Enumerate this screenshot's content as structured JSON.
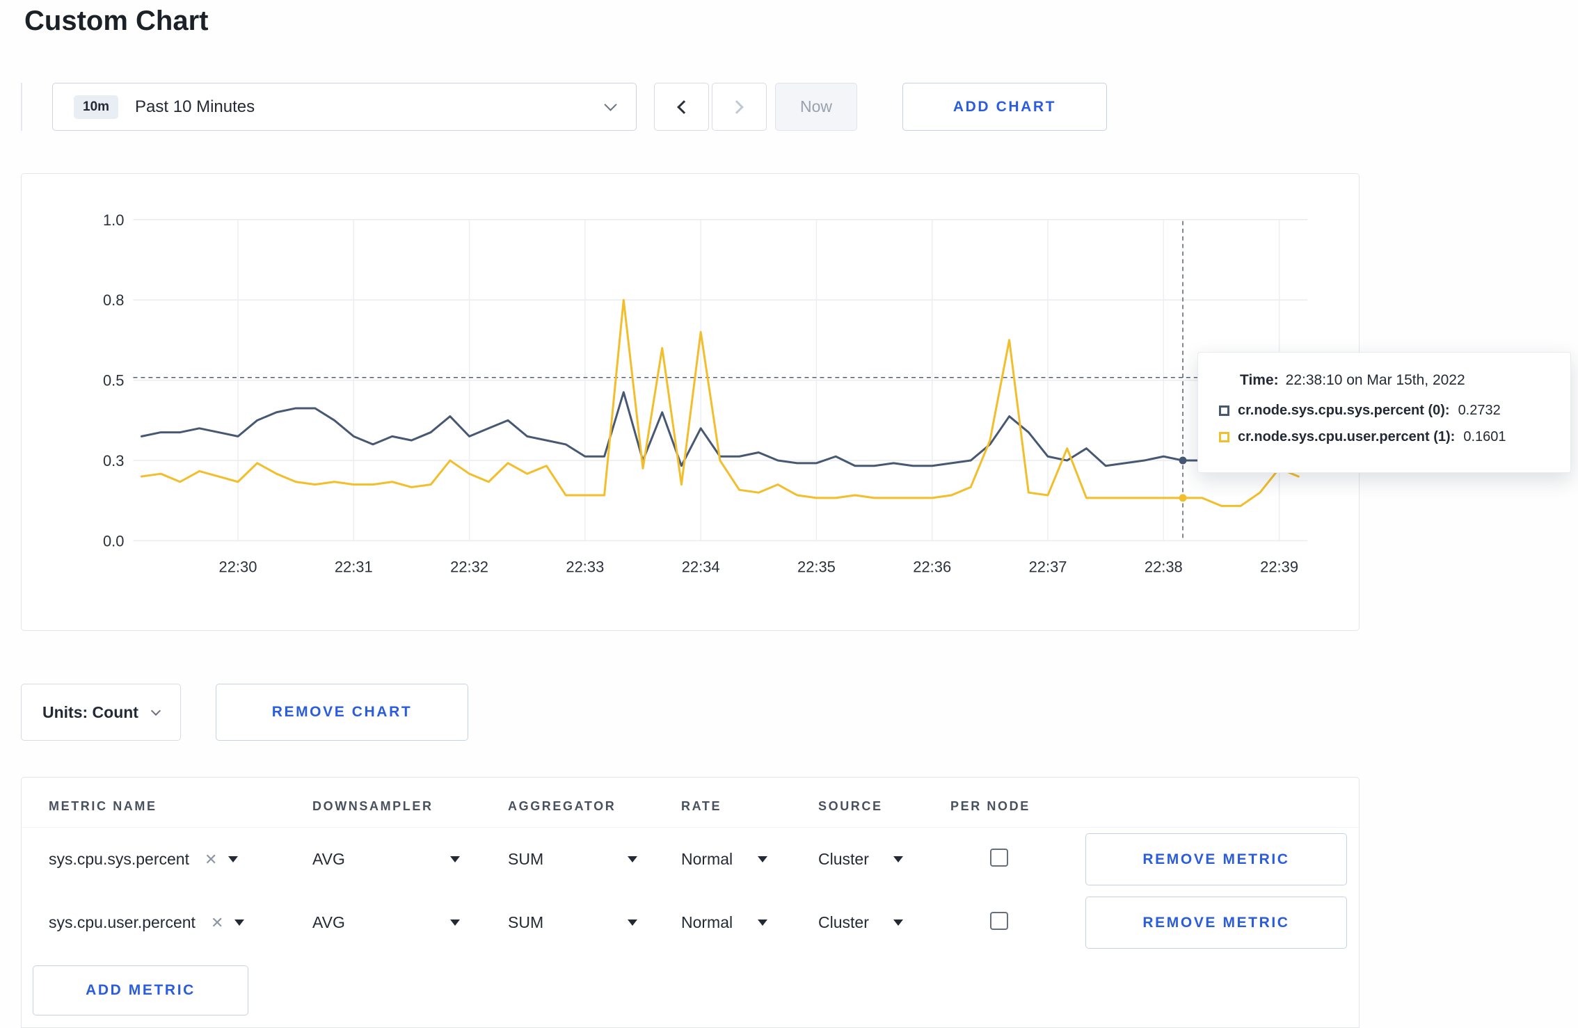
{
  "page": {
    "title": "Custom Chart"
  },
  "toolbar": {
    "time_badge": "10m",
    "time_label": "Past 10 Minutes",
    "now_label": "Now",
    "add_chart_label": "ADD CHART"
  },
  "chart_data": {
    "type": "line",
    "title": "",
    "xlabel": "",
    "ylabel": "",
    "ylim": [
      0,
      1.0
    ],
    "yticks": [
      0.0,
      0.3,
      0.5,
      0.8,
      1.0
    ],
    "x_tick_labels": [
      "22:30",
      "22:31",
      "22:32",
      "22:33",
      "22:34",
      "22:35",
      "22:36",
      "22:37",
      "22:38",
      "22:39"
    ],
    "points_per_minute": 6,
    "grid": true,
    "legend_position": "tooltip",
    "hline_value": 0.51,
    "crosshair_index": 54,
    "crosshair_time": "22:38:10",
    "series": [
      {
        "name": "cr.node.sys.cpu.sys.percent",
        "color": "#475872",
        "values": [
          0.36,
          0.37,
          0.37,
          0.38,
          0.37,
          0.36,
          0.4,
          0.42,
          0.43,
          0.43,
          0.4,
          0.36,
          0.34,
          0.36,
          0.35,
          0.37,
          0.41,
          0.36,
          0.38,
          0.4,
          0.36,
          0.35,
          0.34,
          0.31,
          0.31,
          0.47,
          0.3,
          0.42,
          0.28,
          0.38,
          0.31,
          0.31,
          0.32,
          0.3,
          0.29,
          0.29,
          0.31,
          0.28,
          0.28,
          0.29,
          0.28,
          0.28,
          0.29,
          0.3,
          0.34,
          0.41,
          0.37,
          0.31,
          0.3,
          0.33,
          0.28,
          0.29,
          0.3,
          0.31,
          0.3,
          0.3,
          0.32,
          0.3,
          0.3,
          0.31,
          0.31
        ]
      },
      {
        "name": "cr.node.sys.cpu.user.percent",
        "color": "#f2be2b",
        "values": [
          0.24,
          0.25,
          0.22,
          0.26,
          0.24,
          0.22,
          0.29,
          0.25,
          0.22,
          0.21,
          0.22,
          0.21,
          0.21,
          0.22,
          0.2,
          0.21,
          0.3,
          0.25,
          0.22,
          0.29,
          0.25,
          0.28,
          0.17,
          0.17,
          0.17,
          0.8,
          0.27,
          0.62,
          0.21,
          0.68,
          0.3,
          0.19,
          0.18,
          0.21,
          0.17,
          0.16,
          0.16,
          0.17,
          0.16,
          0.16,
          0.16,
          0.16,
          0.17,
          0.2,
          0.35,
          0.65,
          0.18,
          0.17,
          0.33,
          0.16,
          0.16,
          0.16,
          0.16,
          0.16,
          0.16,
          0.16,
          0.13,
          0.13,
          0.18,
          0.27,
          0.24
        ]
      }
    ]
  },
  "tooltip": {
    "time_label": "Time:",
    "time_value": "22:38:10 on Mar 15th, 2022",
    "rows": [
      {
        "name": "cr.node.sys.cpu.sys.percent (0):",
        "value": "0.2732",
        "color": "#475872"
      },
      {
        "name": "cr.node.sys.cpu.user.percent (1):",
        "value": "0.1601",
        "color": "#f2be2b"
      }
    ]
  },
  "units": {
    "label": "Units: Count",
    "remove_chart_label": "REMOVE CHART"
  },
  "metrics_table": {
    "headers": [
      "METRIC NAME",
      "DOWNSAMPLER",
      "AGGREGATOR",
      "RATE",
      "SOURCE",
      "PER NODE"
    ],
    "rows": [
      {
        "metric": "sys.cpu.sys.percent",
        "downsampler": "AVG",
        "aggregator": "SUM",
        "rate": "Normal",
        "source": "Cluster",
        "per_node_checked": false,
        "remove_label": "REMOVE METRIC"
      },
      {
        "metric": "sys.cpu.user.percent",
        "downsampler": "AVG",
        "aggregator": "SUM",
        "rate": "Normal",
        "source": "Cluster",
        "per_node_checked": false,
        "remove_label": "REMOVE METRIC"
      }
    ],
    "add_metric_label": "ADD METRIC"
  }
}
